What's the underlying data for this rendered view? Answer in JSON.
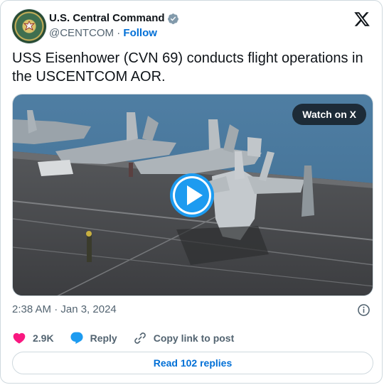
{
  "author": {
    "display_name": "U.S. Central Command",
    "handle": "@CENTCOM",
    "separator": "·",
    "follow_label": "Follow",
    "verified_color": "#829aab",
    "avatar_icon": "centcom-seal"
  },
  "tweet": {
    "text": "USS Eisenhower (CVN 69) conducts flight operations in the USCENTCOM AOR.",
    "media": {
      "type": "video",
      "watch_label": "Watch on X",
      "play_icon": "play-icon"
    },
    "timestamp": "2:38 AM · Jan 3, 2024"
  },
  "actions": {
    "like_count": "2.9K",
    "reply_label": "Reply",
    "copy_label": "Copy link to post"
  },
  "footer": {
    "read_replies_label": "Read 102 replies"
  },
  "colors": {
    "like": "#f91880",
    "reply": "#1d9bf0",
    "link": "#006fd6",
    "muted": "#536471"
  }
}
